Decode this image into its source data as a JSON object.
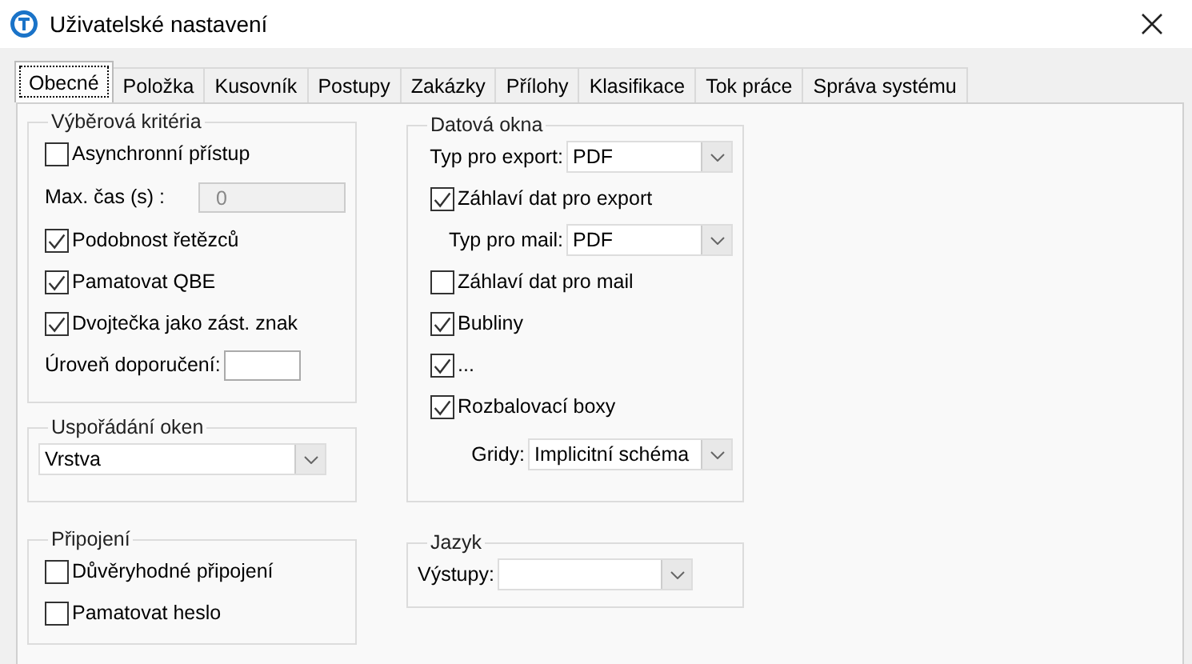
{
  "window": {
    "title": "Uživatelské nastavení"
  },
  "tabs": [
    {
      "label": "Obecné",
      "selected": true
    },
    {
      "label": "Položka",
      "selected": false
    },
    {
      "label": "Kusovník",
      "selected": false
    },
    {
      "label": "Postupy",
      "selected": false
    },
    {
      "label": "Zakázky",
      "selected": false
    },
    {
      "label": "Přílohy",
      "selected": false
    },
    {
      "label": "Klasifikace",
      "selected": false
    },
    {
      "label": "Tok práce",
      "selected": false
    },
    {
      "label": "Správa systému",
      "selected": false
    }
  ],
  "columns": [
    {
      "groups": [
        {
          "title": "Výběrová kritéria",
          "rows": [
            {
              "kind": "checkbox",
              "label": "Asynchronní přístup",
              "checked": false
            },
            {
              "kind": "field",
              "label": "Max. čas (s) :",
              "value": "0",
              "disabled": true
            },
            {
              "kind": "checkbox",
              "label": "Podobnost řetězců",
              "checked": true
            },
            {
              "kind": "checkbox",
              "label": "Pamatovat QBE",
              "checked": true
            },
            {
              "kind": "checkbox",
              "label": "Dvojtečka jako zást. znak",
              "checked": true
            },
            {
              "kind": "field",
              "label": "Úroveň doporučení:",
              "disabled": false
            }
          ]
        },
        {
          "title": "Uspořádání oken",
          "rows": [
            {
              "kind": "combo",
              "value": "Vrstva"
            }
          ]
        },
        {
          "title": "Připojení",
          "rows": [
            {
              "kind": "checkbox",
              "label": "Důvěryhodné připojení",
              "checked": false
            },
            {
              "kind": "checkbox",
              "label": "Pamatovat heslo",
              "checked": false
            }
          ]
        }
      ]
    },
    {
      "groups": [
        {
          "title": "Datová okna",
          "rows": [
            {
              "kind": "combo",
              "label": "Typ pro export:",
              "value": "PDF"
            },
            {
              "kind": "checkbox",
              "label": "Záhlaví dat pro export",
              "checked": true
            },
            {
              "kind": "combo",
              "label": "Typ pro mail:",
              "value": "PDF"
            },
            {
              "kind": "checkbox",
              "label": "Záhlaví dat pro mail",
              "checked": false
            },
            {
              "kind": "checkbox",
              "label": "Bubliny",
              "checked": true
            },
            {
              "kind": "checkbox",
              "label": "...",
              "checked": true
            },
            {
              "kind": "checkbox",
              "label": "Rozbalovací boxy",
              "checked": true
            },
            {
              "kind": "combo",
              "label": "Gridy:",
              "value": "Implicitní schéma"
            }
          ]
        },
        {
          "title": "Jazyk",
          "rows": [
            {
              "kind": "combo",
              "label": "Výstupy:"
            }
          ]
        }
      ]
    }
  ]
}
